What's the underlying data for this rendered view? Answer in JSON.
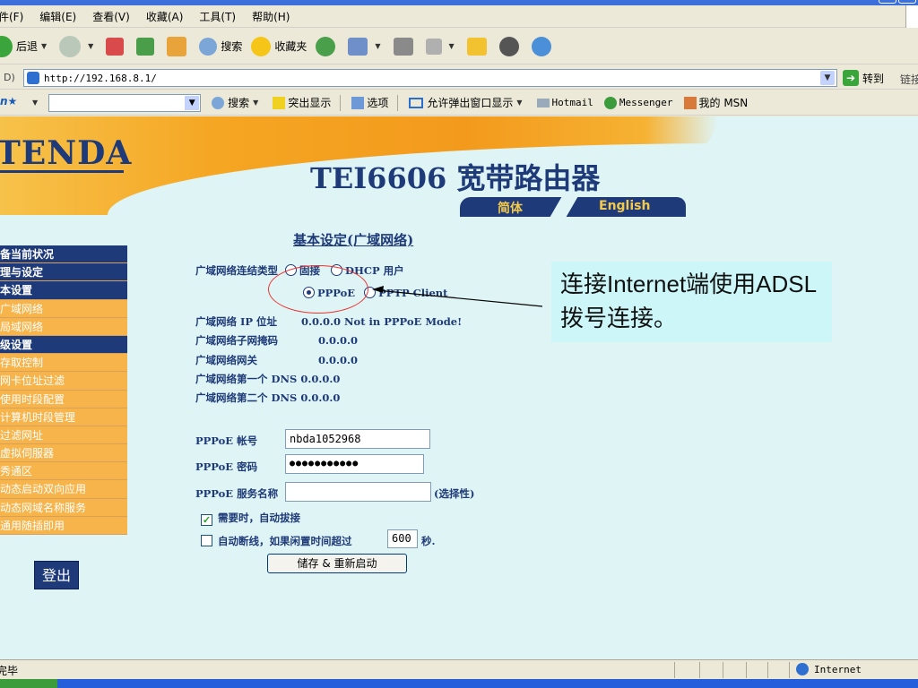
{
  "menu": [
    "件(F)",
    "编辑(E)",
    "查看(V)",
    "收藏(A)",
    "工具(T)",
    "帮助(H)"
  ],
  "toolbar": {
    "back": "后退",
    "search": "搜索",
    "favorites": "收藏夹"
  },
  "address": {
    "label": "D)",
    "url": "http://192.168.8.1/",
    "go": "转到",
    "links": "链接"
  },
  "msnbar": {
    "search": "搜索",
    "highlight": "突出显示",
    "options": "选项",
    "popups": "允许弹出窗口显示",
    "hotmail": "Hotmail",
    "messenger": "Messenger",
    "mymsn": "我的 MSN"
  },
  "page": {
    "logo": "TENDA",
    "product_title": "TEI6606 宽带路由器",
    "lang_simplified": "简体",
    "lang_english": "English",
    "section_title": "基本设定(广域网络)"
  },
  "sidebar": [
    {
      "label": "备当前状况",
      "type": "head"
    },
    {
      "label": "理与设定",
      "type": "head"
    },
    {
      "label": "本设置",
      "type": "head"
    },
    {
      "label": "广域网络",
      "type": "sub"
    },
    {
      "label": "局域网络",
      "type": "sub"
    },
    {
      "label": "级设置",
      "type": "head"
    },
    {
      "label": "存取控制",
      "type": "sub"
    },
    {
      "label": "网卡位址过滤",
      "type": "sub"
    },
    {
      "label": "使用时段配置",
      "type": "sub"
    },
    {
      "label": "计算机时段管理",
      "type": "sub"
    },
    {
      "label": "过滤网址",
      "type": "sub"
    },
    {
      "label": "虚拟伺服器",
      "type": "sub"
    },
    {
      "label": "秀通区",
      "type": "sub"
    },
    {
      "label": "动态启动双向应用",
      "type": "sub"
    },
    {
      "label": "动态网域名称服务",
      "type": "sub"
    },
    {
      "label": "通用随插即用",
      "type": "sub"
    }
  ],
  "logout": "登出",
  "form": {
    "wan_type_label": "广域网络连结类型",
    "opt_fixed": "固接",
    "opt_dhcp": "DHCP 用户",
    "opt_pppoe": "PPPoE",
    "opt_pptp": "PPTP Client",
    "ip_label": "广域网络 IP 位址",
    "ip_value": "0.0.0.0 Not in PPPoE Mode!",
    "mask_label": "广域网络子网掩码",
    "mask_value": "0.0.0.0",
    "gw_label": "广域网络网关",
    "gw_value": "0.0.0.0",
    "dns1_label": "广域网络第一个  DNS",
    "dns1_value": "0.0.0.0",
    "dns2_label": "广域网络第二个  DNS",
    "dns2_value": "0.0.0.0",
    "account_label": "PPPoE 帐号",
    "account_value": "nbda1052968",
    "password_label": "PPPoE 密码",
    "password_value": "●●●●●●●●●●●",
    "service_label": "PPPoE 服务名称",
    "service_value": "",
    "service_hint": "(选择性)",
    "auto_dial_label": "需要时，自动拔接",
    "auto_disc_label": "自动断线，如果闲置时间超过",
    "idle_value": "600",
    "idle_unit": "秒.",
    "save_label": "储存 & 重新启动"
  },
  "callout": "连接Internet端使用ADSL拨号连接。",
  "status": {
    "left": "完毕",
    "zone": "Internet"
  }
}
